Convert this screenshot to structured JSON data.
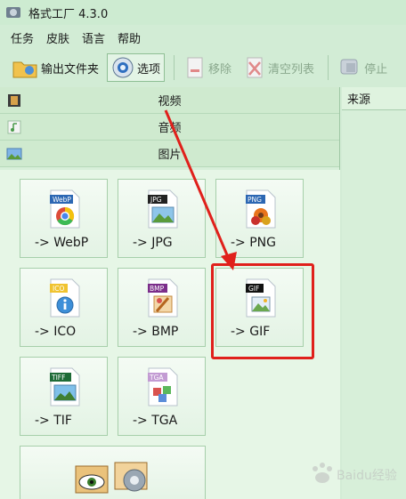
{
  "window": {
    "title": "格式工厂 4.3.0"
  },
  "menu": [
    "任务",
    "皮肤",
    "语言",
    "帮助"
  ],
  "toolbar": {
    "output_folder": "输出文件夹",
    "options": "选项",
    "remove": "移除",
    "clear_list": "清空列表",
    "stop": "停止"
  },
  "categories": {
    "video": "视频",
    "audio": "音频",
    "image": "图片"
  },
  "formats": [
    {
      "label": "-> WebP",
      "tag": "WebP"
    },
    {
      "label": "-> JPG",
      "tag": "JPG"
    },
    {
      "label": "-> PNG",
      "tag": "PNG"
    },
    {
      "label": "-> ICO",
      "tag": "ICO"
    },
    {
      "label": "-> BMP",
      "tag": "BMP"
    },
    {
      "label": "-> GIF",
      "tag": "GIF"
    },
    {
      "label": "-> TIF",
      "tag": "TIFF"
    },
    {
      "label": "-> TGA",
      "tag": "TGA"
    }
  ],
  "right_panel": {
    "column_source": "来源"
  },
  "watermark": {
    "text": "Baidu经验"
  },
  "colors": {
    "highlight": "#e0201b",
    "background": "#d2ecd5"
  }
}
